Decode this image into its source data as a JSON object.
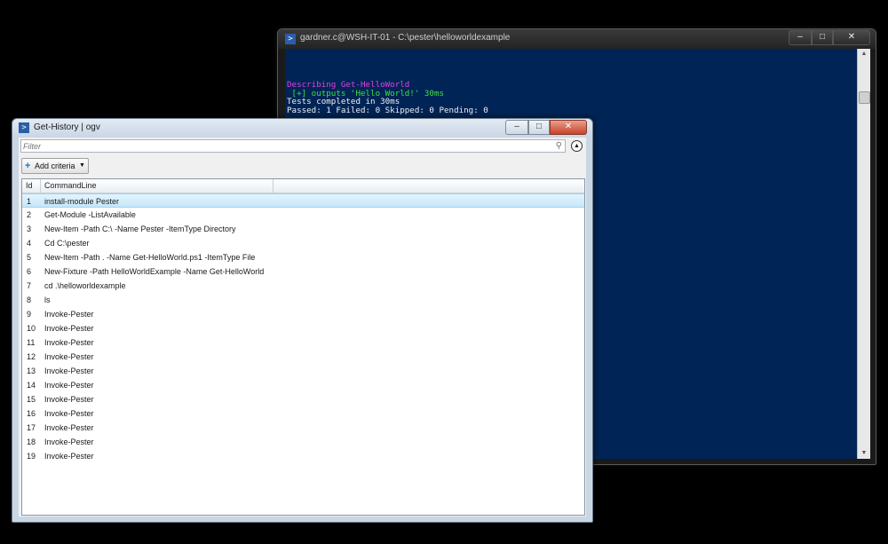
{
  "console": {
    "title": "gardner.c@WSH-IT-01 - C:\\pester\\helloworldexample",
    "lines": [
      {
        "text": "Describing Get-HelloWorld",
        "color": "#e040e0"
      },
      {
        "text": " [+] outputs 'Hello World!' 30ms",
        "color": "#40e040"
      },
      {
        "text": "Tests completed in 30ms",
        "color": "#f0f0f0"
      },
      {
        "text": "Passed: 1 Failed: 0 Skipped: 0 Pending: 0",
        "color": "#f0f0f0"
      }
    ],
    "buttons": {
      "minimize": "–",
      "maximize": "□",
      "close": "✕"
    }
  },
  "ogv": {
    "title": "Get-History | ogv",
    "filter_placeholder": "Filter",
    "add_criteria_label": "Add criteria",
    "buttons": {
      "minimize": "–",
      "maximize": "□",
      "close": "✕"
    },
    "columns": [
      "Id",
      "CommandLine"
    ],
    "rows": [
      {
        "id": "1",
        "cmd": "install-module Pester"
      },
      {
        "id": "2",
        "cmd": "Get-Module -ListAvailable"
      },
      {
        "id": "3",
        "cmd": "New-Item -Path C:\\ -Name Pester -ItemType Directory"
      },
      {
        "id": "4",
        "cmd": "Cd C:\\pester"
      },
      {
        "id": "5",
        "cmd": "New-Item -Path . -Name Get-HelloWorld.ps1 -ItemType File"
      },
      {
        "id": "6",
        "cmd": "New-Fixture -Path HelloWorldExample -Name Get-HelloWorld"
      },
      {
        "id": "7",
        "cmd": "cd .\\helloworldexample"
      },
      {
        "id": "8",
        "cmd": "ls"
      },
      {
        "id": "9",
        "cmd": "Invoke-Pester"
      },
      {
        "id": "10",
        "cmd": "Invoke-Pester"
      },
      {
        "id": "11",
        "cmd": "Invoke-Pester"
      },
      {
        "id": "12",
        "cmd": "Invoke-Pester"
      },
      {
        "id": "13",
        "cmd": "Invoke-Pester"
      },
      {
        "id": "14",
        "cmd": "Invoke-Pester"
      },
      {
        "id": "15",
        "cmd": "Invoke-Pester"
      },
      {
        "id": "16",
        "cmd": "Invoke-Pester"
      },
      {
        "id": "17",
        "cmd": "Invoke-Pester"
      },
      {
        "id": "18",
        "cmd": "Invoke-Pester"
      },
      {
        "id": "19",
        "cmd": "Invoke-Pester"
      }
    ],
    "selected_row": 0
  },
  "icons": {
    "powershell": "powershell-icon",
    "search": "search-icon",
    "collapse": "chevron-up-icon",
    "plus": "plus-icon",
    "dropdown": "caret-down-icon"
  }
}
